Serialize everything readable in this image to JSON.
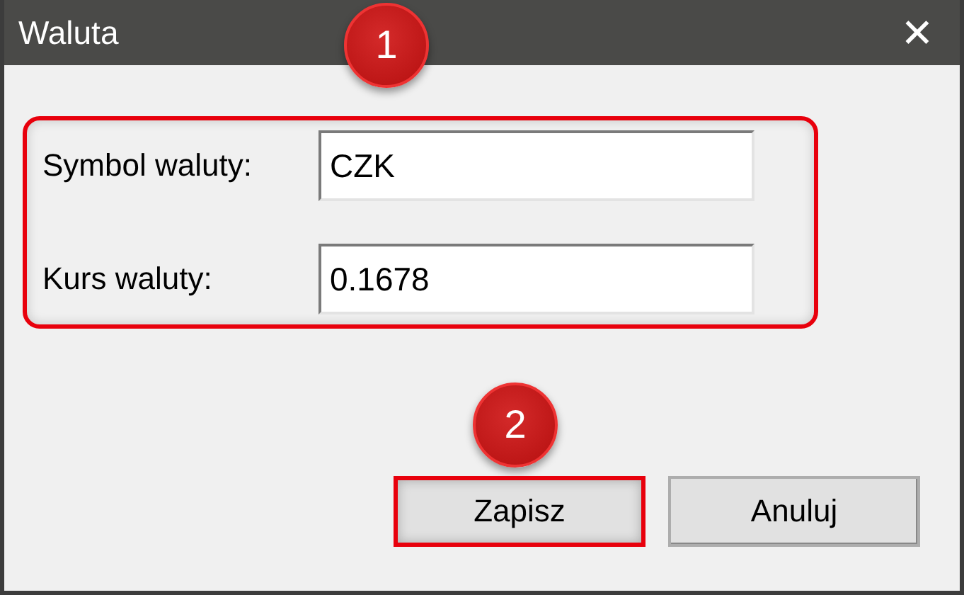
{
  "window": {
    "title": "Waluta",
    "close": "✕"
  },
  "fields_group": {
    "highlighted": true,
    "callout": "1"
  },
  "fields": [
    {
      "label": "Symbol waluty:",
      "value": "CZK"
    },
    {
      "label": "Kurs waluty:",
      "value": "0.1678"
    }
  ],
  "buttons": [
    {
      "label": "Zapisz",
      "highlighted": true,
      "callout": "2"
    },
    {
      "label": "Anuluj",
      "highlighted": false
    }
  ]
}
